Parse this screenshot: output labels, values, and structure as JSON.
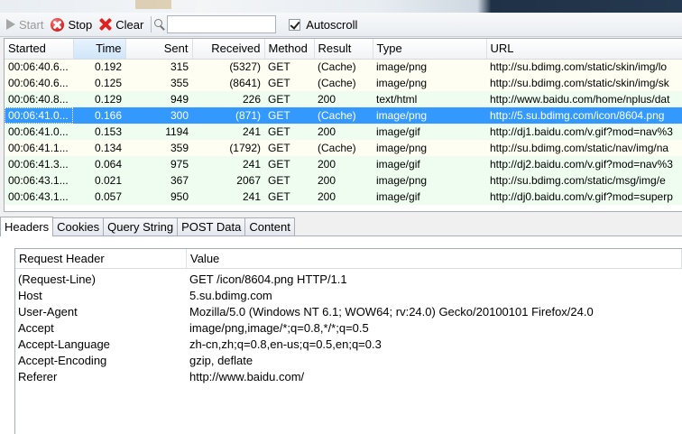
{
  "toolbar": {
    "start_label": "Start",
    "stop_label": "Stop",
    "clear_label": "Clear",
    "search_value": "",
    "autoscroll_label": "Autoscroll",
    "autoscroll_checked": true
  },
  "requests": {
    "columns": [
      "Started",
      "Time",
      "Sent",
      "Received",
      "Method",
      "Result",
      "Type",
      "URL"
    ],
    "sorted_column": "Time",
    "rows": [
      {
        "started": "00:06:40.6...",
        "time": "0.192",
        "sent": "315",
        "received": "(5327)",
        "method": "GET",
        "result": "(Cache)",
        "type": "image/png",
        "url": "http://su.bdimg.com/static/skin/img/lo",
        "style": "cache"
      },
      {
        "started": "00:06:40.6...",
        "time": "0.125",
        "sent": "355",
        "received": "(8641)",
        "method": "GET",
        "result": "(Cache)",
        "type": "image/png",
        "url": "http://su.bdimg.com/static/skin/img/sk",
        "style": "cache"
      },
      {
        "started": "00:06:40.8...",
        "time": "0.129",
        "sent": "949",
        "received": "226",
        "method": "GET",
        "result": "200",
        "type": "text/html",
        "url": "http://www.baidu.com/home/nplus/dat",
        "style": "ok"
      },
      {
        "started": "00:06:41.0...",
        "time": "0.166",
        "sent": "300",
        "received": "(871)",
        "method": "GET",
        "result": "(Cache)",
        "type": "image/png",
        "url": "http://5.su.bdimg.com/icon/8604.png",
        "style": "selected"
      },
      {
        "started": "00:06:41.0...",
        "time": "0.153",
        "sent": "1194",
        "received": "241",
        "method": "GET",
        "result": "200",
        "type": "image/gif",
        "url": "http://dj1.baidu.com/v.gif?mod=nav%3",
        "style": "ok"
      },
      {
        "started": "00:06:41.1...",
        "time": "0.134",
        "sent": "359",
        "received": "(1792)",
        "method": "GET",
        "result": "(Cache)",
        "type": "image/png",
        "url": "http://su.bdimg.com/static/nav/img/na",
        "style": "cache"
      },
      {
        "started": "00:06:41.3...",
        "time": "0.064",
        "sent": "975",
        "received": "241",
        "method": "GET",
        "result": "200",
        "type": "image/gif",
        "url": "http://dj2.baidu.com/v.gif?mod=nav%3",
        "style": "ok"
      },
      {
        "started": "00:06:43.1...",
        "time": "0.021",
        "sent": "367",
        "received": "2067",
        "method": "GET",
        "result": "200",
        "type": "image/png",
        "url": "http://su.bdimg.com/static/msg/img/e",
        "style": "ok"
      },
      {
        "started": "00:06:43.1...",
        "time": "0.057",
        "sent": "950",
        "received": "241",
        "method": "GET",
        "result": "200",
        "type": "image/gif",
        "url": "http://dj0.baidu.com/v.gif?mod=superp",
        "style": "ok"
      }
    ]
  },
  "tabs": [
    {
      "label": "Headers",
      "active": true
    },
    {
      "label": "Cookies",
      "active": false
    },
    {
      "label": "Query String",
      "active": false
    },
    {
      "label": "POST Data",
      "active": false
    },
    {
      "label": "Content",
      "active": false
    }
  ],
  "headers_panel": {
    "col_name": "Request Header",
    "col_value": "Value",
    "rows": [
      {
        "name": "(Request-Line)",
        "value": "GET /icon/8604.png HTTP/1.1"
      },
      {
        "name": "Host",
        "value": "5.su.bdimg.com"
      },
      {
        "name": "User-Agent",
        "value": "Mozilla/5.0 (Windows NT 6.1; WOW64; rv:24.0) Gecko/20100101 Firefox/24.0"
      },
      {
        "name": "Accept",
        "value": "image/png,image/*;q=0.8,*/*;q=0.5"
      },
      {
        "name": "Accept-Language",
        "value": "zh-cn,zh;q=0.8,en-us;q=0.5,en;q=0.3"
      },
      {
        "name": "Accept-Encoding",
        "value": "gzip, deflate"
      },
      {
        "name": "Referer",
        "value": "http://www.baidu.com/"
      }
    ]
  },
  "colors": {
    "selection": "#3399ff",
    "row_cache": "#fefff2",
    "row_ok": "#eefdef",
    "sorted_header": "#cfe6f9"
  },
  "icons": {
    "start": "play-icon",
    "stop": "stop-icon",
    "clear": "clear-icon",
    "search": "search-icon"
  }
}
